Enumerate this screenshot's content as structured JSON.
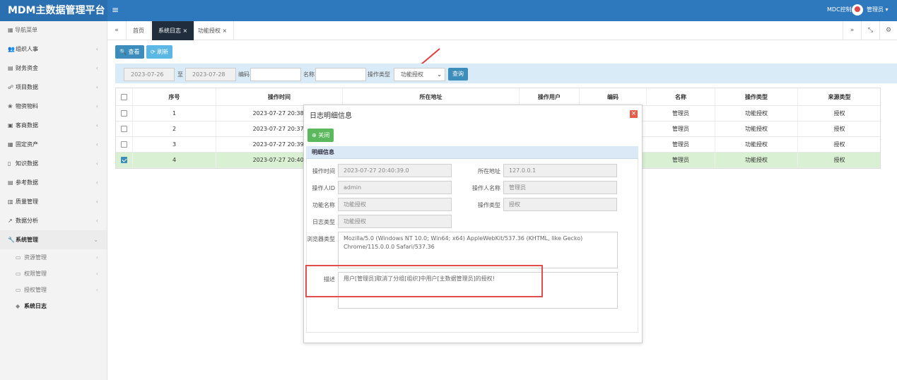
{
  "app": {
    "title": "MDM主数据管理平台",
    "menu_toggle": "≡",
    "console": "MDC控制台",
    "user": "管理员 ▾"
  },
  "sidebar": {
    "header": "导航菜单",
    "items": [
      {
        "icon": "👥",
        "label": "组织人事"
      },
      {
        "icon": "▤",
        "label": "财务资金"
      },
      {
        "icon": "☍",
        "label": "项目数据"
      },
      {
        "icon": "❀",
        "label": "物资物料"
      },
      {
        "icon": "▣",
        "label": "客商数据"
      },
      {
        "icon": "▦",
        "label": "固定资产"
      },
      {
        "icon": "▯",
        "label": "知识数据"
      },
      {
        "icon": "▤",
        "label": "参考数据"
      },
      {
        "icon": "▥",
        "label": "质量管理"
      },
      {
        "icon": "↗",
        "label": "数据分析"
      },
      {
        "icon": "🔧",
        "label": "系统管理"
      }
    ],
    "sub_items": [
      {
        "label": "资源管理"
      },
      {
        "label": "权限管理"
      },
      {
        "label": "授权管理"
      },
      {
        "label": "系统日志"
      }
    ]
  },
  "tabs": {
    "prev": "«",
    "items": [
      {
        "label": "首页"
      },
      {
        "label": "系统日志 ×"
      },
      {
        "label": "功能授权 ×"
      }
    ],
    "next": "»",
    "expand": "⤡",
    "settings": "⚙"
  },
  "toolbar": {
    "view": "查看",
    "refresh": "刷新"
  },
  "filter": {
    "date_start": "2023-07-26",
    "to": "至",
    "date_end": "2023-07-28",
    "code_label": "编码",
    "name_label": "名称",
    "type_label": "操作类型",
    "type_value": "功能授权",
    "query": "查询"
  },
  "grid": {
    "headers": [
      "序号",
      "操作时间",
      "所在地址",
      "操作用户",
      "编码",
      "名称",
      "操作类型",
      "来源类型"
    ],
    "rows": [
      {
        "no": "1",
        "time": "2023-07-27 20:38:",
        "name": "管理员",
        "op": "功能授权",
        "src": "授权",
        "checked": false
      },
      {
        "no": "2",
        "time": "2023-07-27 20:37:",
        "name": "管理员",
        "op": "功能授权",
        "src": "授权",
        "checked": false
      },
      {
        "no": "3",
        "time": "2023-07-27 20:39:",
        "name": "管理员",
        "op": "功能授权",
        "src": "授权",
        "checked": false
      },
      {
        "no": "4",
        "time": "2023-07-27 20:40:",
        "name": "管理员",
        "op": "功能授权",
        "src": "授权",
        "checked": true
      }
    ]
  },
  "modal": {
    "title": "日志明细信息",
    "close_btn": "关闭",
    "section": "明细信息",
    "op_time_label": "操作时间",
    "op_time": "2023-07-27 20:40:39.0",
    "addr_label": "所在地址",
    "addr": "127.0.0.1",
    "user_id_label": "操作人ID",
    "user_id": "admin",
    "user_name_label": "操作人名称",
    "user_name": "管理员",
    "func_label": "功能名称",
    "func": "功能授权",
    "op_type_label": "操作类型",
    "op_type": "授权",
    "log_type_label": "日志类型",
    "log_type": "功能授权",
    "browser_label": "浏览器类型",
    "browser": "Mozilla/5.0 (Windows NT 10.0; Win64; x64) AppleWebKit/537.36 (KHTML, like Gecko) Chrome/115.0.0.0 Safari/537.36",
    "desc_label": "描述",
    "desc": "用户[管理员]取消了分组[组织]中用户[主数据管理员]的授权!"
  }
}
